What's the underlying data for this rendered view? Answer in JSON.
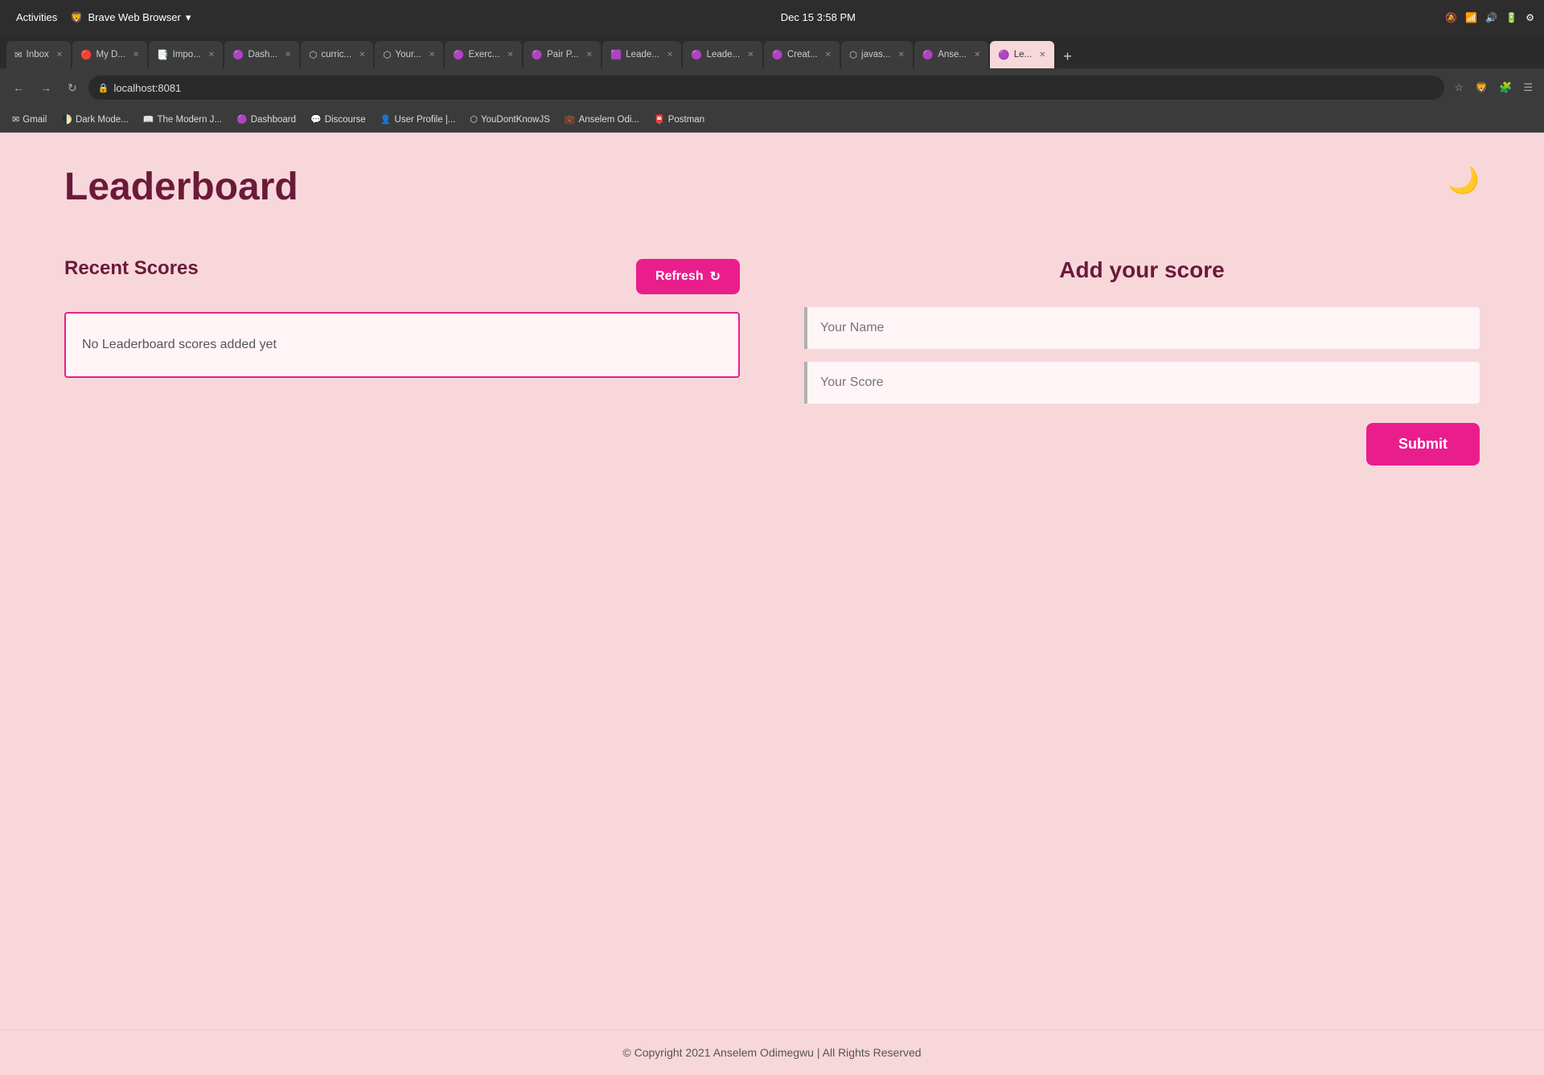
{
  "os": {
    "activities_label": "Activities",
    "browser_title": "Brave Web Browser",
    "datetime": "Dec 15  3:58 PM"
  },
  "browser": {
    "url": "localhost:8081",
    "tabs": [
      {
        "label": "Inbox",
        "icon": "✉",
        "active": false
      },
      {
        "label": "My D...",
        "icon": "🔴",
        "active": false
      },
      {
        "label": "Impo...",
        "icon": "📑",
        "active": false
      },
      {
        "label": "Dash...",
        "icon": "🟣",
        "active": false
      },
      {
        "label": "curric...",
        "icon": "⬡",
        "active": false
      },
      {
        "label": "Your ...",
        "icon": "⬡",
        "active": false
      },
      {
        "label": "Exerc...",
        "icon": "🟣",
        "active": false
      },
      {
        "label": "Pair P...",
        "icon": "🟣",
        "active": false
      },
      {
        "label": "Leade...",
        "icon": "🟪",
        "active": false
      },
      {
        "label": "Leade...",
        "icon": "🟣",
        "active": false
      },
      {
        "label": "Creat...",
        "icon": "🟣",
        "active": false
      },
      {
        "label": "javas...",
        "icon": "⬡",
        "active": false
      },
      {
        "label": "Anse...",
        "icon": "🟣",
        "active": false
      },
      {
        "label": "Le...",
        "icon": "🟣",
        "active": true
      }
    ],
    "bookmarks": [
      {
        "label": "Gmail",
        "icon": "✉"
      },
      {
        "label": "Dark Mode...",
        "icon": "🌓"
      },
      {
        "label": "The Modern J...",
        "icon": "🔖"
      },
      {
        "label": "Dashboard",
        "icon": "🟣"
      },
      {
        "label": "Discourse",
        "icon": "💬"
      },
      {
        "label": "User Profile |...",
        "icon": "👤"
      },
      {
        "label": "YouDontKnowJS",
        "icon": "⬡"
      },
      {
        "label": "Anselem Odi...",
        "icon": "💼"
      },
      {
        "label": "Postman",
        "icon": "📮"
      }
    ]
  },
  "page": {
    "title": "Leaderboard",
    "dark_mode_icon": "🌙",
    "recent_scores": {
      "section_title": "Recent Scores",
      "refresh_label": "Refresh",
      "refresh_icon": "↻",
      "empty_message": "No Leaderboard scores added yet"
    },
    "add_score": {
      "section_title": "Add your score",
      "name_placeholder": "Your Name",
      "score_placeholder": "Your Score",
      "submit_label": "Submit"
    },
    "footer": "© Copyright 2021 Anselem Odimegwu | All Rights Reserved"
  }
}
